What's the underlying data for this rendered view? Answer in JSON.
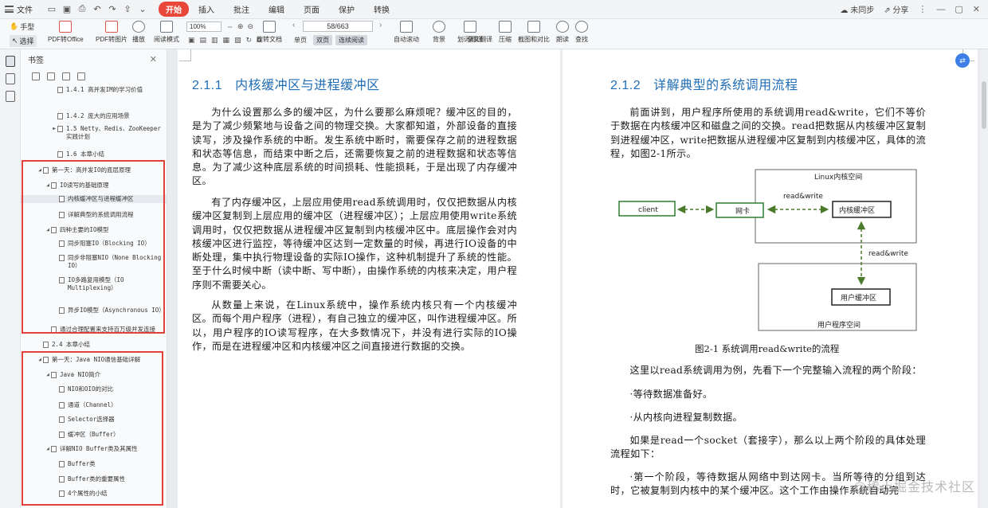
{
  "menubar": {
    "file": "文件",
    "menus": [
      "开始",
      "插入",
      "批注",
      "编辑",
      "页面",
      "保护",
      "转换"
    ],
    "sync": "未同步",
    "share": "分享"
  },
  "toolbar": {
    "hand": "手型",
    "select": "选择",
    "pdf_office": "PDF转Office",
    "pdf_image": "PDF转图片",
    "play": "播放",
    "read_mode": "阅读模式",
    "zoom": "100%",
    "rotate": "旋转文档",
    "single": "单页",
    "double": "双页",
    "continuous": "连续阅读",
    "auto_scroll": "自动滚动",
    "background": "背景",
    "translate": "划词翻译",
    "full_translate": "全文翻译",
    "compress": "压缩",
    "screenshot": "截图和对比",
    "read_aloud": "朗读",
    "search": "查找",
    "page": "58/663"
  },
  "bookmarks": {
    "title": "书签",
    "items": [
      {
        "text": "1.4.1 高并发IM的学习价值",
        "arrow": ""
      },
      {
        "text": "1.4.2 庞大的应用场景",
        "arrow": ""
      },
      {
        "text": "1.5 Netty、Redis、ZooKeeper实践计划",
        "arrow": "▶"
      },
      {
        "text": "1.6 本章小结",
        "arrow": ""
      },
      {
        "text": "第一天：高并发IO的底层原理",
        "arrow": "◢"
      },
      {
        "text": "IO读写的基础原理",
        "arrow": "◢"
      },
      {
        "text": "内核缓冲区与进程缓冲区",
        "arrow": ""
      },
      {
        "text": "详解典型的系统调用流程",
        "arrow": ""
      },
      {
        "text": "四种主要的IO模型",
        "arrow": "◢"
      },
      {
        "text": "同步阻塞IO（Blocking IO）",
        "arrow": ""
      },
      {
        "text": "同步非阻塞NIO（None Blocking IO）",
        "arrow": ""
      },
      {
        "text": "IO多路复用模型（IO Multiplexing）",
        "arrow": ""
      },
      {
        "text": "异步IO模型（Asynchronous IO）",
        "arrow": ""
      },
      {
        "text": "通过合理配置来支持百万级并发连接",
        "arrow": ""
      },
      {
        "text": "2.4 本章小结",
        "arrow": ""
      },
      {
        "text": "第一天：Java NIO通信基础详解",
        "arrow": "◢"
      },
      {
        "text": "Java NIO简介",
        "arrow": "◢"
      },
      {
        "text": "NIO和OIO的对比",
        "arrow": ""
      },
      {
        "text": "通道（Channel）",
        "arrow": ""
      },
      {
        "text": "Selector选择器",
        "arrow": ""
      },
      {
        "text": "缓冲区（Buffer）",
        "arrow": ""
      },
      {
        "text": "详解NIO Buffer类及其属性",
        "arrow": "◢"
      },
      {
        "text": "Buffer类",
        "arrow": ""
      },
      {
        "text": "Buffer类的重要属性",
        "arrow": ""
      },
      {
        "text": "4个属性的小结",
        "arrow": ""
      }
    ]
  },
  "left_page": {
    "heading_num": "2.1.1",
    "heading": "内核缓冲区与进程缓冲区",
    "paragraphs": [
      "为什么设置那么多的缓冲区，为什么要那么麻烦呢？缓冲区的目的，是为了减少频繁地与设备之间的物理交换。大家都知道，外部设备的直接读写，涉及操作系统的中断。发生系统中断时，需要保存之前的进程数据和状态等信息，而结束中断之后，还需要恢复之前的进程数据和状态等信息。为了减少这种底层系统的时间损耗、性能损耗，于是出现了内存缓冲区。",
      "有了内存缓冲区，上层应用使用read系统调用时，仅仅把数据从内核缓冲区复制到上层应用的缓冲区（进程缓冲区）；上层应用使用write系统调用时，仅仅把数据从进程缓冲区复制到内核缓冲区中。底层操作会对内核缓冲区进行监控，等待缓冲区达到一定数量的时候，再进行IO设备的中断处理，集中执行物理设备的实际IO操作，这种机制提升了系统的性能。至于什么时候中断（读中断、写中断），由操作系统的内核来决定，用户程序则不需要关心。",
      "从数量上来说，在Linux系统中，操作系统内核只有一个内核缓冲区。而每个用户程序（进程），有自己独立的缓冲区，叫作进程缓冲区。所以，用户程序的IO读写程序，在大多数情况下，并没有进行实际的IO操作，而是在进程缓冲区和内核缓冲区之间直接进行数据的交换。"
    ]
  },
  "right_page": {
    "heading_num": "2.1.2",
    "heading": "详解典型的系统调用流程",
    "paragraphs": [
      "前面讲到，用户程序所使用的系统调用read&write，它们不等价于数据在内核缓冲区和磁盘之间的交换。read把数据从内核缓冲区复制到进程缓冲区，write把数据从进程缓冲区复制到内核缓冲区，具体的流程，如图2-1所示。",
      "这里以read系统调用为例，先看下一个完整输入流程的两个阶段：",
      "·等待数据准备好。",
      "·从内核向进程复制数据。",
      "如果是read一个socket（套接字），那么以上两个阶段的具体处理流程如下：",
      "·第一个阶段，等待数据从网络中到达网卡。当所等待的分组到达时，它被复制到内核中的某个缓冲区。这个工作由操作系统自动完"
    ],
    "figure": {
      "kernel_space": "Linux内核空间",
      "user_space": "用户程序空间",
      "client": "client",
      "nic": "网卡",
      "kernel_buffer": "内核缓冲区",
      "user_buffer": "用户缓冲区",
      "rw1": "read&write",
      "rw2": "read&write",
      "caption": "图2-1  系统调用read&write的流程",
      "box_color": "#2e7d32",
      "arrow_color": "#4a7a2a"
    }
  },
  "watermark": "@稀土掘金技术社区"
}
